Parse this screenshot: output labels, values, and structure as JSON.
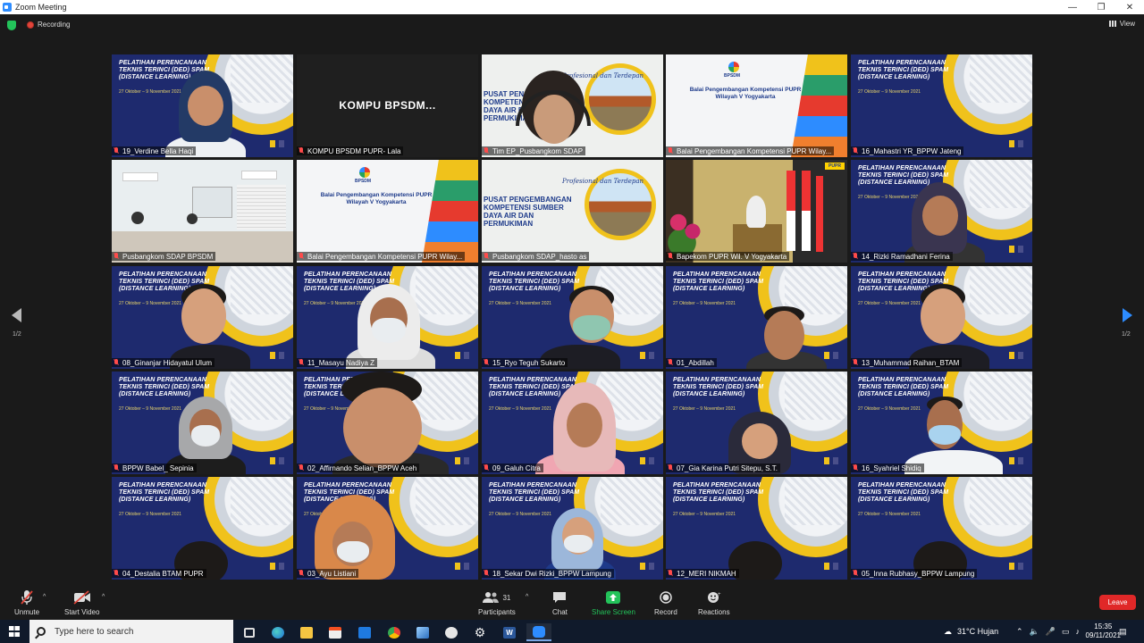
{
  "window": {
    "title": "Zoom Meeting",
    "minimize": "—",
    "maximize": "❐",
    "close": "✕"
  },
  "meeting": {
    "recording_label": "Recording",
    "view_label": "View"
  },
  "gallery": {
    "page_indicator_left": "1/2",
    "page_indicator_right": "1/2",
    "banner": {
      "title": "Pelatihan Perencanaan Teknis Terinci (DED) SPAM (Distance Learning)",
      "subtitle": "27 Oktober – 9 November 2021"
    },
    "bpsdm_card": {
      "logo_label": "BPSDM",
      "title": "Balai Pengembangan Kompetensi PUPR Wilayah V Yogyakarta"
    },
    "pusat_card": {
      "title": "PUSAT PENGEMBANGAN KOMPETENSI SUMBER DAYA AIR DAN PERMUKIMAN",
      "script": "Profesional dan Terdepan"
    },
    "kompu_tile_text": "KOMPU BPSDM...",
    "pu_logo_text": "PUPR",
    "tiles": [
      {
        "name": "19_Verdine Bella Haqi",
        "type": "banner",
        "person": "hijab-navy"
      },
      {
        "name": "KOMPU BPSDM PUPR- Lala",
        "type": "blank"
      },
      {
        "name": "Tim EP_Pusbangkom SDAP",
        "type": "pusat-person"
      },
      {
        "name": "Balai Pengembangan Kompetensi PUPR Wilay...",
        "type": "bpsdm"
      },
      {
        "name": "16_Mahastri YR_BPPW Jateng",
        "type": "banner",
        "person": "none"
      },
      {
        "name": "Pusbangkom SDAP BPSDM",
        "type": "room"
      },
      {
        "name": "Balai Pengembangan Kompetensi PUPR Wilay...",
        "type": "bpsdm"
      },
      {
        "name": "Pusbangkom SDAP_hasto as",
        "type": "pusat"
      },
      {
        "name": "Bapekom PUPR Wil. V Yogyakarta",
        "type": "stage"
      },
      {
        "name": "14_Rizki Ramadhani Ferina",
        "type": "banner",
        "person": "hijab-dark"
      },
      {
        "name": "08_Ginanjar Hidayatul Ulum",
        "type": "banner",
        "person": "man"
      },
      {
        "name": "11_Masayu Nadiya Z",
        "type": "banner",
        "person": "hijab-white-mask"
      },
      {
        "name": "15_Ryo Teguh Sukarto",
        "type": "banner",
        "person": "man-mask"
      },
      {
        "name": "01_Abdillah",
        "type": "banner",
        "person": "man-low"
      },
      {
        "name": "13_Muhammad Raihan_BTAM",
        "type": "banner",
        "person": "man"
      },
      {
        "name": "BPPW Babel_ Sepinia",
        "type": "banner",
        "person": "hijab-grey-mask"
      },
      {
        "name": "02_Affirnando Selian_BPPW Aceh",
        "type": "banner",
        "person": "man-close"
      },
      {
        "name": "09_Galuh Citra",
        "type": "banner",
        "person": "hijab-pink"
      },
      {
        "name": "07_Gia Karina Putri Sitepu, S.T.",
        "type": "banner",
        "person": "hijab-low"
      },
      {
        "name": "16_Syahriel Shidiq",
        "type": "banner",
        "person": "man-mask-shirt"
      },
      {
        "name": "04_Destalia BTAM PUPR",
        "type": "banner",
        "person": "head-low"
      },
      {
        "name": "03_Ayu Listiani",
        "type": "banner",
        "person": "hijab-floral"
      },
      {
        "name": "18_Sekar Dwi Rizki_BPPW Lampung",
        "type": "banner",
        "person": "hijab-mask"
      },
      {
        "name": "12_MERI NIKMAH",
        "type": "banner",
        "person": "head-low"
      },
      {
        "name": "05_Inna Rubhasy_BPPW Lampung",
        "type": "banner",
        "person": "head-low"
      }
    ]
  },
  "toolbar": {
    "unmute": "Unmute",
    "start_video": "Start Video",
    "participants": "Participants",
    "participants_count": "31",
    "chat": "Chat",
    "share_screen": "Share Screen",
    "record": "Record",
    "reactions": "Reactions",
    "leave": "Leave"
  },
  "taskbar": {
    "search_placeholder": "Type here to search",
    "weather": "31°C  Hujan",
    "time": "15:35",
    "date": "09/11/2021"
  },
  "colors": {
    "accent_green": "#23c35a",
    "leave_red": "#e02828",
    "active_speaker": "#c7da1d",
    "banner_navy": "#1e2a6e",
    "banner_gold": "#f0c21b"
  }
}
